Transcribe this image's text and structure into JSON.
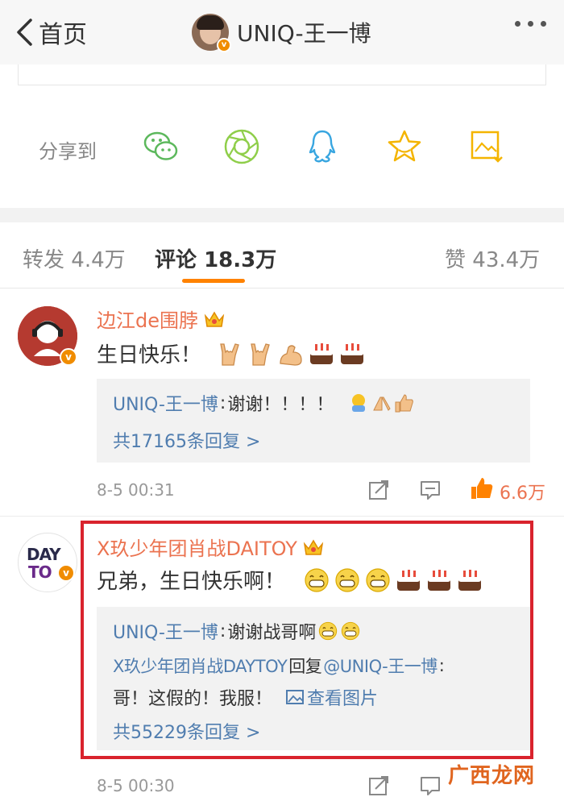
{
  "nav": {
    "back_label": "首页",
    "title": "UNIQ-王一博"
  },
  "share": {
    "label": "分享到",
    "targets": [
      "wechat-icon",
      "moments-icon",
      "qq-icon",
      "favorite-star-icon",
      "save-image-icon"
    ]
  },
  "tabs": {
    "repost_label": "转发",
    "repost_count": "4.4万",
    "comment_label": "评论",
    "comment_count": "18.3万",
    "like_label": "赞",
    "like_count": "43.4万"
  },
  "comments": [
    {
      "author": "边江de围脖",
      "text": "生日快乐！",
      "emojis": [
        "rock-hand",
        "rock-hand",
        "flex-arm",
        "cake",
        "cake"
      ],
      "replies": [
        {
          "author": "UNIQ-王一博",
          "sep": ": ",
          "text": "谢谢！！！！",
          "emojis": [
            "hug-face",
            "pray-hands",
            "thumbs-up"
          ]
        }
      ],
      "more_replies": "共17165条回复 >",
      "time": "8-5 00:31",
      "likes": "6.6万"
    },
    {
      "author": "X玖少年团肖战DAITOY",
      "avatar_text_top": "DAY",
      "avatar_text_bottom": "TO",
      "text": "兄弟，生日快乐啊！",
      "emojis": [
        "grin",
        "grin",
        "grin",
        "cake",
        "cake",
        "cake"
      ],
      "replies": [
        {
          "author": "UNIQ-王一博",
          "sep": ": ",
          "text": "谢谢战哥啊",
          "emojis": [
            "grin",
            "grin"
          ]
        },
        {
          "author": "X玖少年团肖战DAYTOY",
          "mid": "回复",
          "at": "@UNIQ-王一博",
          "sep": ":"
        }
      ],
      "reply_cont": "哥！这假的！我服！",
      "view_image": "查看图片",
      "more_replies": "共55229条回复 >",
      "time": "8-5 00:30"
    }
  ],
  "watermark": {
    "text": "广西龙网"
  },
  "colors": {
    "accent": "#ff8200",
    "name_orange": "#eb7350",
    "link_blue": "#507daf",
    "highlight_red": "#d9232d"
  }
}
